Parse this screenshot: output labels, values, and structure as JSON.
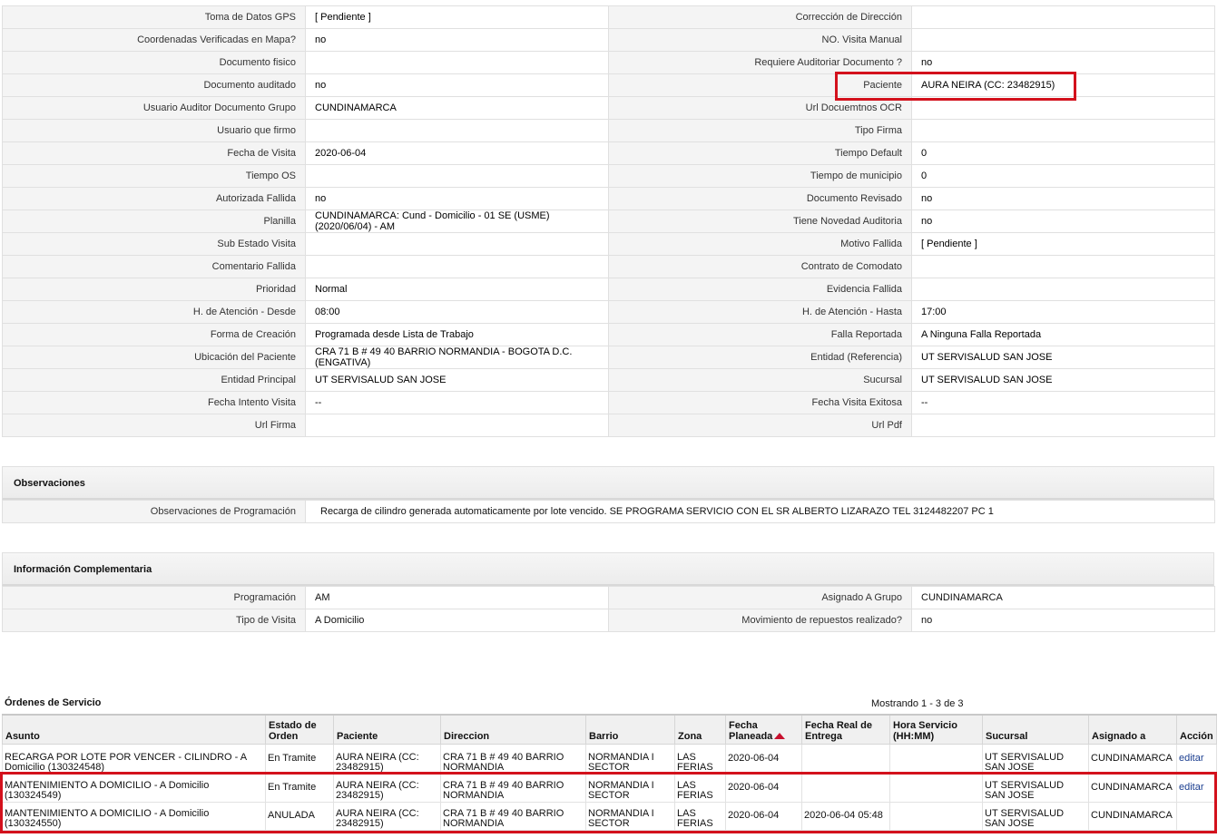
{
  "details": [
    {
      "l1": "Toma de Datos GPS",
      "v1": "[ Pendiente ]",
      "l2": "Corrección de Dirección",
      "v2": ""
    },
    {
      "l1": "Coordenadas Verificadas en Mapa?",
      "v1": " no",
      "l2": "NO. Visita Manual",
      "v2": ""
    },
    {
      "l1": "Documento fisico",
      "v1": "",
      "l2": "Requiere Auditoriar Documento ?",
      "v2": " no"
    },
    {
      "l1": "Documento auditado",
      "v1": " no",
      "l2": "Paciente",
      "v2": "AURA NEIRA (CC: 23482915)"
    },
    {
      "l1": "Usuario Auditor Documento Grupo",
      "v1": "CUNDINAMARCA",
      "l2": "Url Docuemtnos OCR",
      "v2": ""
    },
    {
      "l1": "Usuario que firmo",
      "v1": "",
      "l2": "Tipo Firma",
      "v2": ""
    },
    {
      "l1": "Fecha de Visita",
      "v1": " 2020-06-04",
      "l2": "Tiempo Default",
      "v2": "0"
    },
    {
      "l1": "Tiempo OS",
      "v1": "",
      "l2": "Tiempo de municipio",
      "v2": "0"
    },
    {
      "l1": "Autorizada Fallida",
      "v1": " no",
      "l2": "Documento Revisado",
      "v2": " no"
    },
    {
      "l1": "Planilla",
      "v1": "CUNDINAMARCA: Cund - Domicilio - 01 SE (USME) (2020/06/04) - AM",
      "l2": "Tiene Novedad Auditoria",
      "v2": " no"
    },
    {
      "l1": "Sub Estado Visita",
      "v1": "",
      "l2": "Motivo Fallida",
      "v2": "[ Pendiente ]"
    },
    {
      "l1": "Comentario Fallida",
      "v1": "",
      "l2": "Contrato de Comodato",
      "v2": ""
    },
    {
      "l1": "Prioridad",
      "v1": "Normal",
      "l2": "Evidencia Fallida",
      "v2": ""
    },
    {
      "l1": "H. de Atención - Desde",
      "v1": "08:00",
      "l2": "H. de Atención - Hasta",
      "v2": "17:00"
    },
    {
      "l1": "Forma de Creación",
      "v1": "Programada desde Lista de Trabajo",
      "l2": "Falla Reportada",
      "v2": "A Ninguna Falla Reportada"
    },
    {
      "l1": "Ubicación del Paciente",
      "v1": "CRA 71 B # 49 40 BARRIO NORMANDIA - BOGOTA D.C. (ENGATIVA)",
      "l2": "Entidad (Referencia)",
      "v2": "UT SERVISALUD SAN JOSE"
    },
    {
      "l1": "Entidad Principal",
      "v1": "UT SERVISALUD SAN JOSE",
      "l2": "Sucursal",
      "v2": "UT SERVISALUD SAN JOSE"
    },
    {
      "l1": "Fecha Intento Visita",
      "v1": " --",
      "l2": "Fecha Visita Exitosa",
      "v2": " --"
    },
    {
      "l1": "Url Firma",
      "v1": "",
      "l2": "Url Pdf",
      "v2": ""
    }
  ],
  "observaciones": {
    "title": "Observaciones",
    "label": "Observaciones de Programación",
    "value": "Recarga de cilindro generada automaticamente por lote vencido. SE PROGRAMA SERVICIO CON EL SR ALBERTO LIZARAZO TEL 3124482207 PC 1"
  },
  "info": {
    "title": "Información Complementaria",
    "rows": [
      {
        "l1": "Programación",
        "v1": "AM",
        "l2": "Asignado A Grupo",
        "v2": "CUNDINAMARCA"
      },
      {
        "l1": "Tipo de Visita",
        "v1": "A Domicilio",
        "l2": "Movimiento de repuestos realizado?",
        "v2": " no"
      }
    ]
  },
  "orders": {
    "title": "Órdenes de Servicio",
    "count_text": "Mostrando 1 - 3 de 3",
    "columns": [
      "Asunto",
      "Estado de Orden",
      "Paciente",
      "Direccion",
      "Barrio",
      "Zona",
      "Fecha Planeada",
      "Fecha Real de Entrega",
      "Hora Servicio (HH:MM)",
      "Sucursal",
      "Asignado a",
      "Acción"
    ],
    "rows": [
      {
        "asunto": "RECARGA POR LOTE POR VENCER - CILINDRO - A Domicilio (130324548)",
        "estado": "En Tramite",
        "paciente": "AURA NEIRA (CC: 23482915)",
        "direccion": "CRA 71 B # 49 40 BARRIO NORMANDIA",
        "barrio": "NORMANDIA I SECTOR",
        "zona": "LAS FERIAS",
        "fecha_planeada": "2020-06-04",
        "fecha_real": "",
        "hora": "",
        "sucursal": "UT SERVISALUD SAN JOSE",
        "asignado": "CUNDINAMARCA",
        "accion": "editar"
      },
      {
        "asunto": "MANTENIMIENTO A DOMICILIO - A Domicilio (130324549)",
        "estado": "En Tramite",
        "paciente": "AURA NEIRA (CC: 23482915)",
        "direccion": "CRA 71 B # 49 40 BARRIO NORMANDIA",
        "barrio": "NORMANDIA I SECTOR",
        "zona": "LAS FERIAS",
        "fecha_planeada": "2020-06-04",
        "fecha_real": "",
        "hora": "",
        "sucursal": "UT SERVISALUD SAN JOSE",
        "asignado": "CUNDINAMARCA",
        "accion": "editar"
      },
      {
        "asunto": "MANTENIMIENTO A DOMICILIO - A Domicilio (130324550)",
        "estado": "ANULADA",
        "paciente": "AURA NEIRA (CC: 23482915)",
        "direccion": "CRA 71 B # 49 40 BARRIO NORMANDIA",
        "barrio": "NORMANDIA I SECTOR",
        "zona": "LAS FERIAS",
        "fecha_planeada": "2020-06-04",
        "fecha_real": "2020-06-04 05:48",
        "hora": "",
        "sucursal": "UT SERVISALUD SAN JOSE",
        "asignado": "CUNDINAMARCA",
        "accion": ""
      }
    ]
  },
  "colors": {
    "highlight": "#d3111c",
    "link": "#1a3d8f"
  }
}
